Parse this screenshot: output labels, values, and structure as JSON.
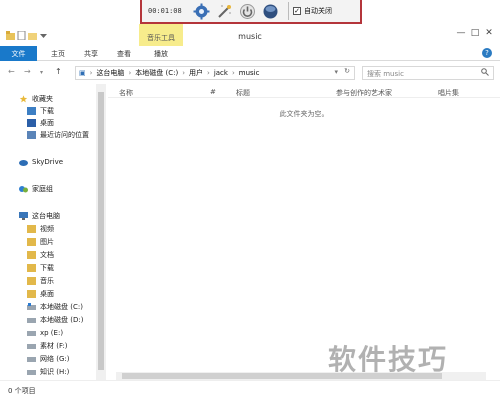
{
  "timer": {
    "time": "00:01:08",
    "auto_close_label": "自动关闭",
    "auto_close_checked": "✓"
  },
  "window": {
    "title": "music",
    "context_tab": "音乐工具",
    "controls": [
      "—",
      "□",
      "✕"
    ]
  },
  "ribbon": {
    "tabs": [
      "文件",
      "主页",
      "共享",
      "查看",
      "播放"
    ],
    "help": "?"
  },
  "address": {
    "path": [
      "这台电脑",
      "本地磁盘 (C:)",
      "用户",
      "jack",
      "music"
    ],
    "search_placeholder": "搜索 music"
  },
  "nav": {
    "favorites": {
      "label": "收藏夹",
      "items": [
        "下载",
        "桌面",
        "最近访问的位置"
      ]
    },
    "skydrive": "SkyDrive",
    "homegroup": "家庭组",
    "pc": {
      "label": "这台电脑",
      "items": [
        "视频",
        "图片",
        "文档",
        "下载",
        "音乐",
        "桌面",
        "本地磁盘 (C:)",
        "本地磁盘 (D:)",
        "xp (E:)",
        "素材 (F:)",
        "网络 (G:)",
        "知识 (H:)"
      ]
    }
  },
  "columns": [
    "名称",
    "#",
    "标题",
    "参与创作的艺术家",
    "唱片集"
  ],
  "empty_message": "此文件夹为空。",
  "status": {
    "count": "0 个项目"
  },
  "watermark": "软件技巧"
}
